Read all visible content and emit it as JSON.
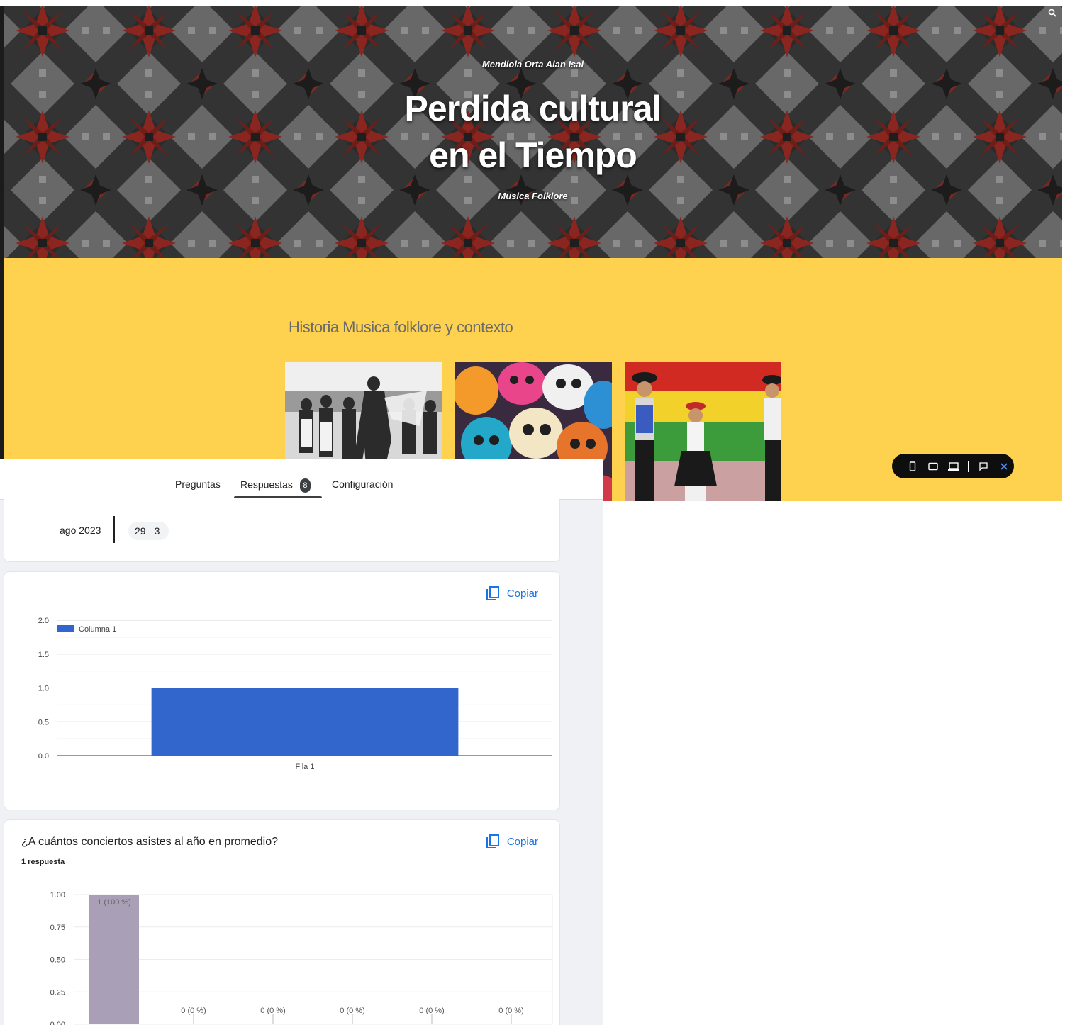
{
  "site": {
    "author": "Mendiola Orta Alan Isai",
    "title_line1": "Perdida cultural",
    "title_line2": "en el Tiempo",
    "subtitle": "Musica Folklore",
    "section_heading": "Historia Musica folklore y contexto",
    "photos": [
      {
        "name": "folk-dancers-photo",
        "desc_icon": "bw-dancers"
      },
      {
        "name": "sugar-skulls-photo",
        "desc_icon": "sugar-skulls"
      },
      {
        "name": "costume-dancers-photo",
        "desc_icon": "andean-dancers"
      }
    ],
    "colors": {
      "banner_red": "#9c2a22",
      "banner_dark": "#1d1d1d",
      "banner_grey": "#7a7a7a",
      "section_bg": "#fed24e"
    },
    "toolbar_icons": [
      "phone-icon",
      "tablet-icon",
      "laptop-icon",
      "feedback-icon",
      "close-icon"
    ]
  },
  "forms": {
    "tabs": [
      {
        "label": "Preguntas"
      },
      {
        "label": "Respuestas",
        "badge": "8"
      },
      {
        "label": "Configuración"
      }
    ],
    "date_card": {
      "month": "ago 2023",
      "day": "29",
      "count": "3"
    },
    "copy_label": "Copiar",
    "grid_card": {
      "chart_data": {
        "type": "bar",
        "categories": [
          "Fila 1"
        ],
        "series": [
          {
            "name": "Columna 1",
            "values": [
              1
            ]
          }
        ],
        "ylim": [
          0,
          2
        ],
        "yticks": [
          "2.0",
          "1.5",
          "1.0",
          "0.5",
          "0.0"
        ],
        "legend": "top-left",
        "grid": true,
        "color": "#3366cc"
      }
    },
    "question_card": {
      "title": "¿A cuántos conciertos asistes al año en promedio?",
      "responses": "1 respuesta",
      "chart_data": {
        "type": "bar",
        "values": [
          1,
          0,
          0,
          0,
          0,
          0
        ],
        "labels": [
          "1 (100 %)",
          "0 (0 %)",
          "0 (0 %)",
          "0 (0 %)",
          "0 (0 %)",
          "0 (0 %)"
        ],
        "ylim": [
          0,
          1
        ],
        "yticks": [
          "1.00",
          "0.75",
          "0.50",
          "0.25",
          "0.00"
        ],
        "color": "#a9a0b8"
      }
    }
  }
}
